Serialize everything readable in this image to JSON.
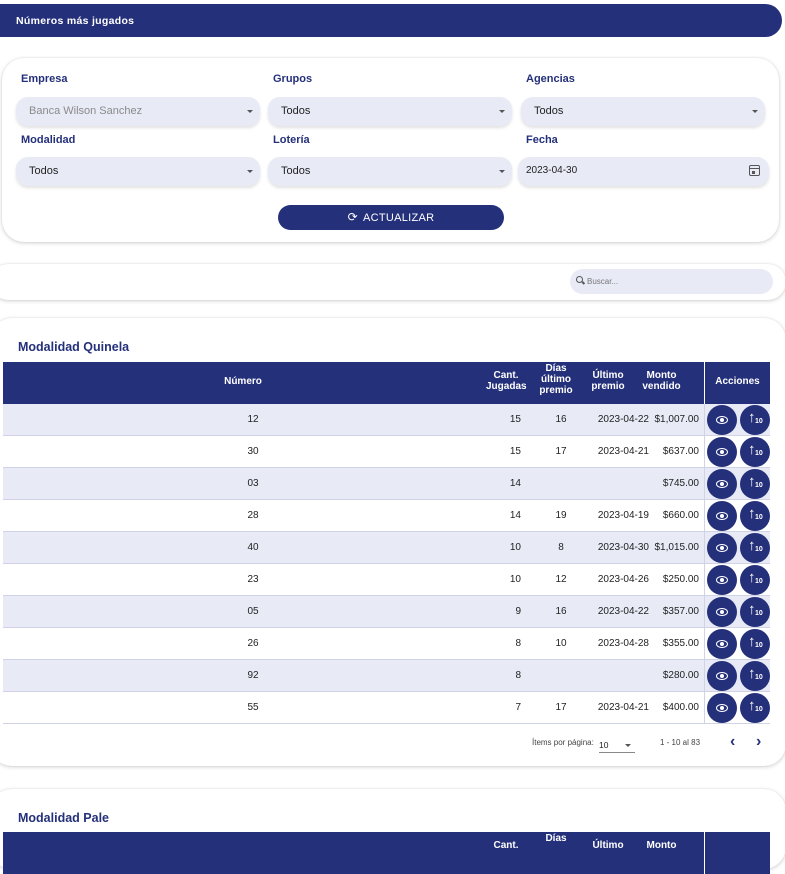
{
  "header": {
    "title": "Números más jugados"
  },
  "filters": {
    "empresa": {
      "label": "Empresa",
      "value": "Banca Wilson Sanchez"
    },
    "grupos": {
      "label": "Grupos",
      "value": "Todos"
    },
    "agencias": {
      "label": "Agencias",
      "value": "Todos"
    },
    "modalidad": {
      "label": "Modalidad",
      "value": "Todos"
    },
    "loteria": {
      "label": "Lotería",
      "value": "Todos"
    },
    "fecha": {
      "label": "Fecha",
      "value": "2023-04-30"
    },
    "update_label": "ACTUALIZAR",
    "refresh_icon": "refresh-icon"
  },
  "search": {
    "placeholder": "Buscar..."
  },
  "columns": {
    "numero": "Número",
    "cant_1": "Cant.",
    "cant_2": "Jugadas",
    "dias_1": "Días",
    "dias_2": "último",
    "dias_3": "premio",
    "ultimo_1": "Último",
    "ultimo_2": "premio",
    "monto_1": "Monto",
    "monto_2": "vendido",
    "acciones": "Acciones"
  },
  "quinela": {
    "title": "Modalidad Quinela",
    "rows": [
      {
        "numero": "12",
        "cant": "15",
        "dias": "16",
        "ultimo": "2023-04-22",
        "monto": "$1,007.00"
      },
      {
        "numero": "30",
        "cant": "15",
        "dias": "17",
        "ultimo": "2023-04-21",
        "monto": "$637.00"
      },
      {
        "numero": "03",
        "cant": "14",
        "dias": "",
        "ultimo": "",
        "monto": "$745.00"
      },
      {
        "numero": "28",
        "cant": "14",
        "dias": "19",
        "ultimo": "2023-04-19",
        "monto": "$660.00"
      },
      {
        "numero": "40",
        "cant": "10",
        "dias": "8",
        "ultimo": "2023-04-30",
        "monto": "$1,015.00"
      },
      {
        "numero": "23",
        "cant": "10",
        "dias": "12",
        "ultimo": "2023-04-26",
        "monto": "$250.00"
      },
      {
        "numero": "05",
        "cant": "9",
        "dias": "16",
        "ultimo": "2023-04-22",
        "monto": "$357.00"
      },
      {
        "numero": "26",
        "cant": "8",
        "dias": "10",
        "ultimo": "2023-04-28",
        "monto": "$355.00"
      },
      {
        "numero": "92",
        "cant": "8",
        "dias": "",
        "ultimo": "",
        "monto": "$280.00"
      },
      {
        "numero": "55",
        "cant": "7",
        "dias": "17",
        "ultimo": "2023-04-21",
        "monto": "$400.00"
      }
    ],
    "pager": {
      "items_label": "Ítems por página:",
      "page_size": "10",
      "range": "1 - 10 al 83"
    }
  },
  "pale": {
    "title": "Modalidad Pale"
  },
  "icons": {
    "view": "eye-icon",
    "top10": "arrow-up-10-icon",
    "next": "chevron-right-icon",
    "prev": "chevron-left-icon"
  },
  "colors": {
    "primary": "#24307a",
    "row_alt": "#e8eaf6"
  }
}
